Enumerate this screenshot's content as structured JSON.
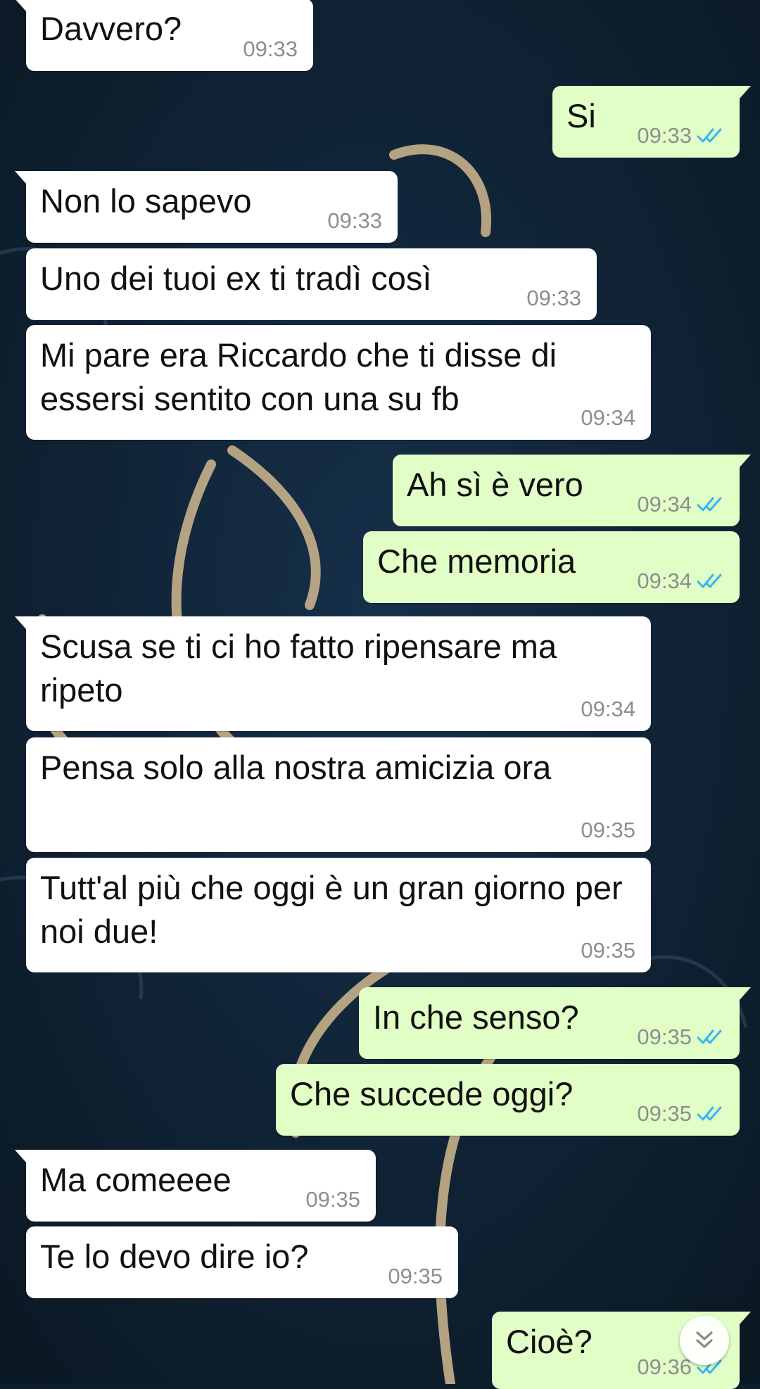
{
  "theme": {
    "incoming_bubble": "#ffffff",
    "outgoing_bubble": "#e1fec6",
    "read_receipt": "#34b7f1",
    "wallpaper": "#0d1e2c",
    "wallpaper_ornament": "#c7b08a"
  },
  "messages": [
    {
      "direction": "in",
      "text": "Davvero?",
      "time": "09:33"
    },
    {
      "direction": "out",
      "text": "Si",
      "time": "09:33",
      "status": "read"
    },
    {
      "direction": "in",
      "text": "Non lo sapevo",
      "time": "09:33"
    },
    {
      "direction": "in",
      "text": "Uno dei tuoi ex ti tradì così",
      "time": "09:33"
    },
    {
      "direction": "in",
      "text": "Mi pare era Riccardo che ti disse di essersi sentito con una su fb",
      "time": "09:34"
    },
    {
      "direction": "out",
      "text": "Ah sì è vero",
      "time": "09:34",
      "status": "read"
    },
    {
      "direction": "out",
      "text": "Che memoria",
      "time": "09:34",
      "status": "read"
    },
    {
      "direction": "in",
      "text": "Scusa se ti ci ho fatto ripensare ma ripeto",
      "time": "09:34"
    },
    {
      "direction": "in",
      "text": "Pensa solo alla nostra amicizia ora",
      "time": "09:35"
    },
    {
      "direction": "in",
      "text": "Tutt'al più che oggi è un gran giorno per noi due!",
      "time": "09:35"
    },
    {
      "direction": "out",
      "text": "In che senso?",
      "time": "09:35",
      "status": "read"
    },
    {
      "direction": "out",
      "text": "Che succede oggi?",
      "time": "09:35",
      "status": "read"
    },
    {
      "direction": "in",
      "text": "Ma comeeee",
      "time": "09:35"
    },
    {
      "direction": "in",
      "text": "Te lo devo dire io?",
      "time": "09:35"
    },
    {
      "direction": "out",
      "text": "Cioè?",
      "time": "09:36",
      "status": "read"
    }
  ],
  "scroll_button": {
    "icon": "double-chevron-down-icon"
  }
}
